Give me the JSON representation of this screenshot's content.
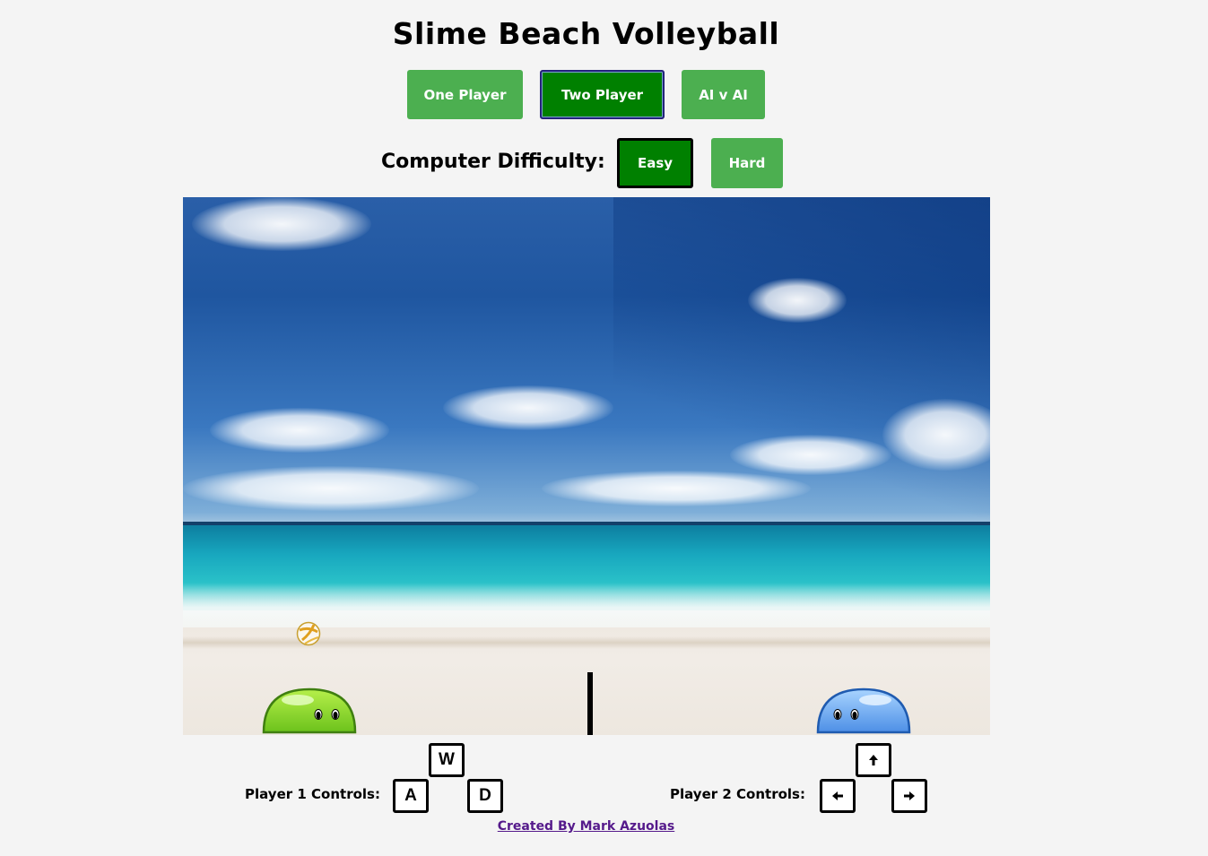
{
  "title": "Slime Beach Volleyball",
  "modes": [
    {
      "label": "One Player",
      "selected": false
    },
    {
      "label": "Two Player",
      "selected": true
    },
    {
      "label": "AI v AI",
      "selected": false
    }
  ],
  "difficulty": {
    "label": "Computer Difficulty:",
    "options": [
      {
        "label": "Easy",
        "selected": true
      },
      {
        "label": "Hard",
        "selected": false
      }
    ]
  },
  "game": {
    "scene": "beach",
    "player1_color": "#7ed321",
    "player2_color": "#4a90e2",
    "ball_icon": "volleyball-icon"
  },
  "controls": {
    "player1": {
      "label": "Player 1 Controls:",
      "up": "W",
      "left": "A",
      "right": "D"
    },
    "player2": {
      "label": "Player 2 Controls:",
      "up": "arrow-up-icon",
      "left": "arrow-left-icon",
      "right": "arrow-right-icon"
    }
  },
  "footer": {
    "credit": "Created By Mark Azuolas"
  },
  "colors": {
    "button": "#4caf50",
    "button_selected": "#008000",
    "link": "#551a8b"
  }
}
